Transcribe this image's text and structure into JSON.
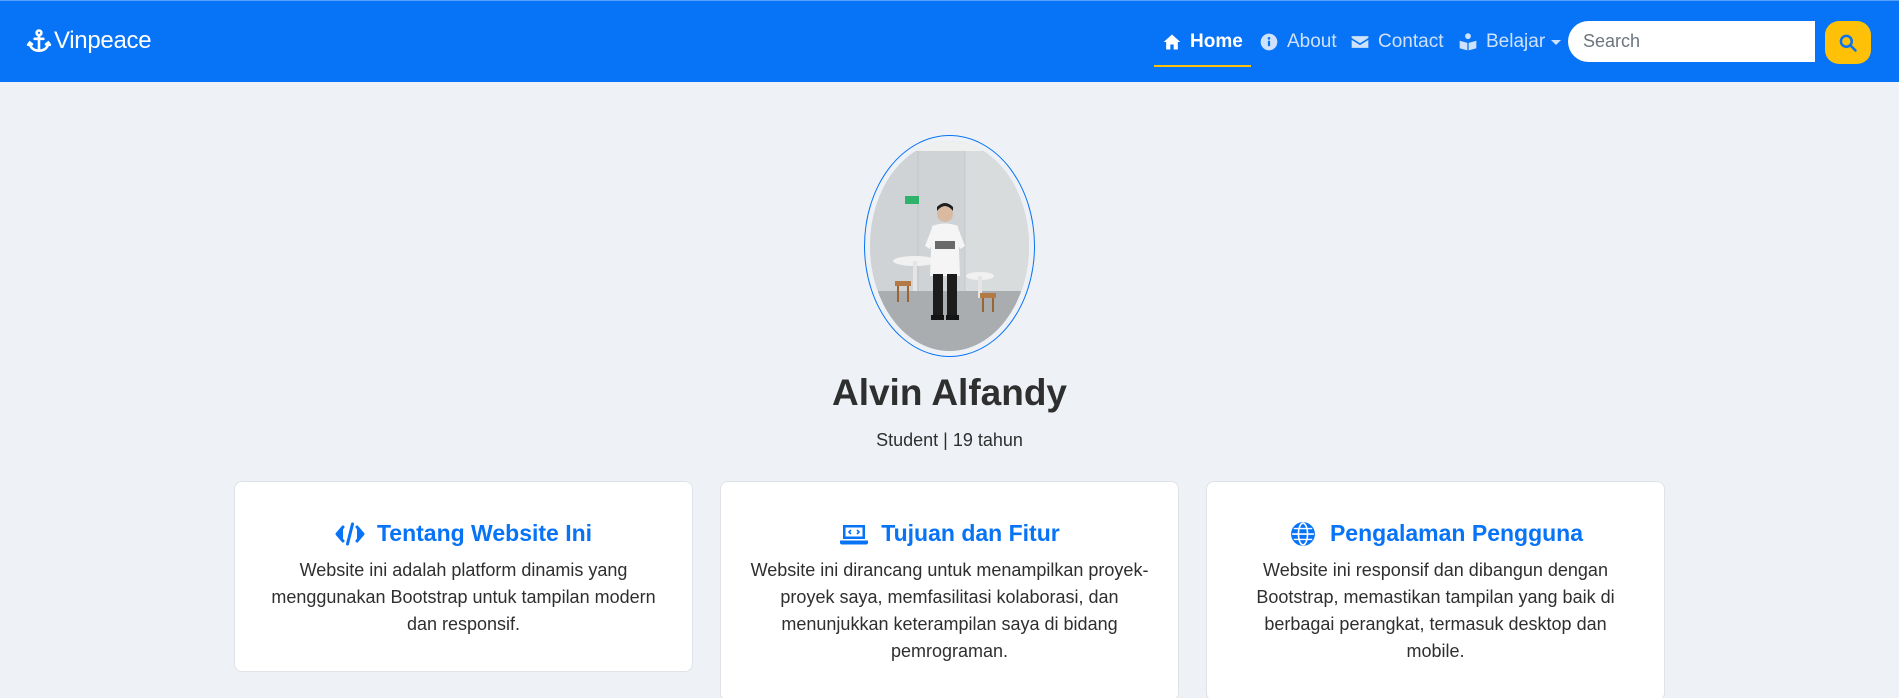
{
  "brand": {
    "name": "Vinpeace",
    "icon": "anchor-icon"
  },
  "nav": {
    "items": [
      {
        "label": "Home",
        "icon": "home-icon",
        "active": true
      },
      {
        "label": "About",
        "icon": "info-circle-icon"
      },
      {
        "label": "Contact",
        "icon": "envelope-icon"
      },
      {
        "label": "Belajar",
        "icon": "book-reader-icon",
        "dropdown": true
      }
    ],
    "accent": "#ffc107"
  },
  "search": {
    "placeholder": "Search",
    "value": "",
    "button_icon": "search-icon"
  },
  "profile": {
    "name": "Alvin Alfandy",
    "subtitle": "Student | 19 tahun",
    "photo_icon": "profile-photo"
  },
  "cards": [
    {
      "icon": "code-icon",
      "title": "Tentang Website Ini",
      "text": "Website ini adalah platform dinamis yang menggunakan Bootstrap untuk tampilan modern dan responsif."
    },
    {
      "icon": "laptop-code-icon",
      "title": "Tujuan dan Fitur",
      "text": "Website ini dirancang untuk menampilkan proyek-proyek saya, memfasilitasi kolaborasi, dan menunjukkan keterampilan saya di bidang pemrograman."
    },
    {
      "icon": "globe-icon",
      "title": "Pengalaman Pengguna",
      "text": "Website ini responsif dan dibangun dengan Bootstrap, memastikan tampilan yang baik di berbagai perangkat, termasuk desktop dan mobile."
    }
  ],
  "colors": {
    "navbar": "#0773f7",
    "page_background": "#eef2f6",
    "title_blue": "#0773f7",
    "search_button": "#ffc107"
  }
}
